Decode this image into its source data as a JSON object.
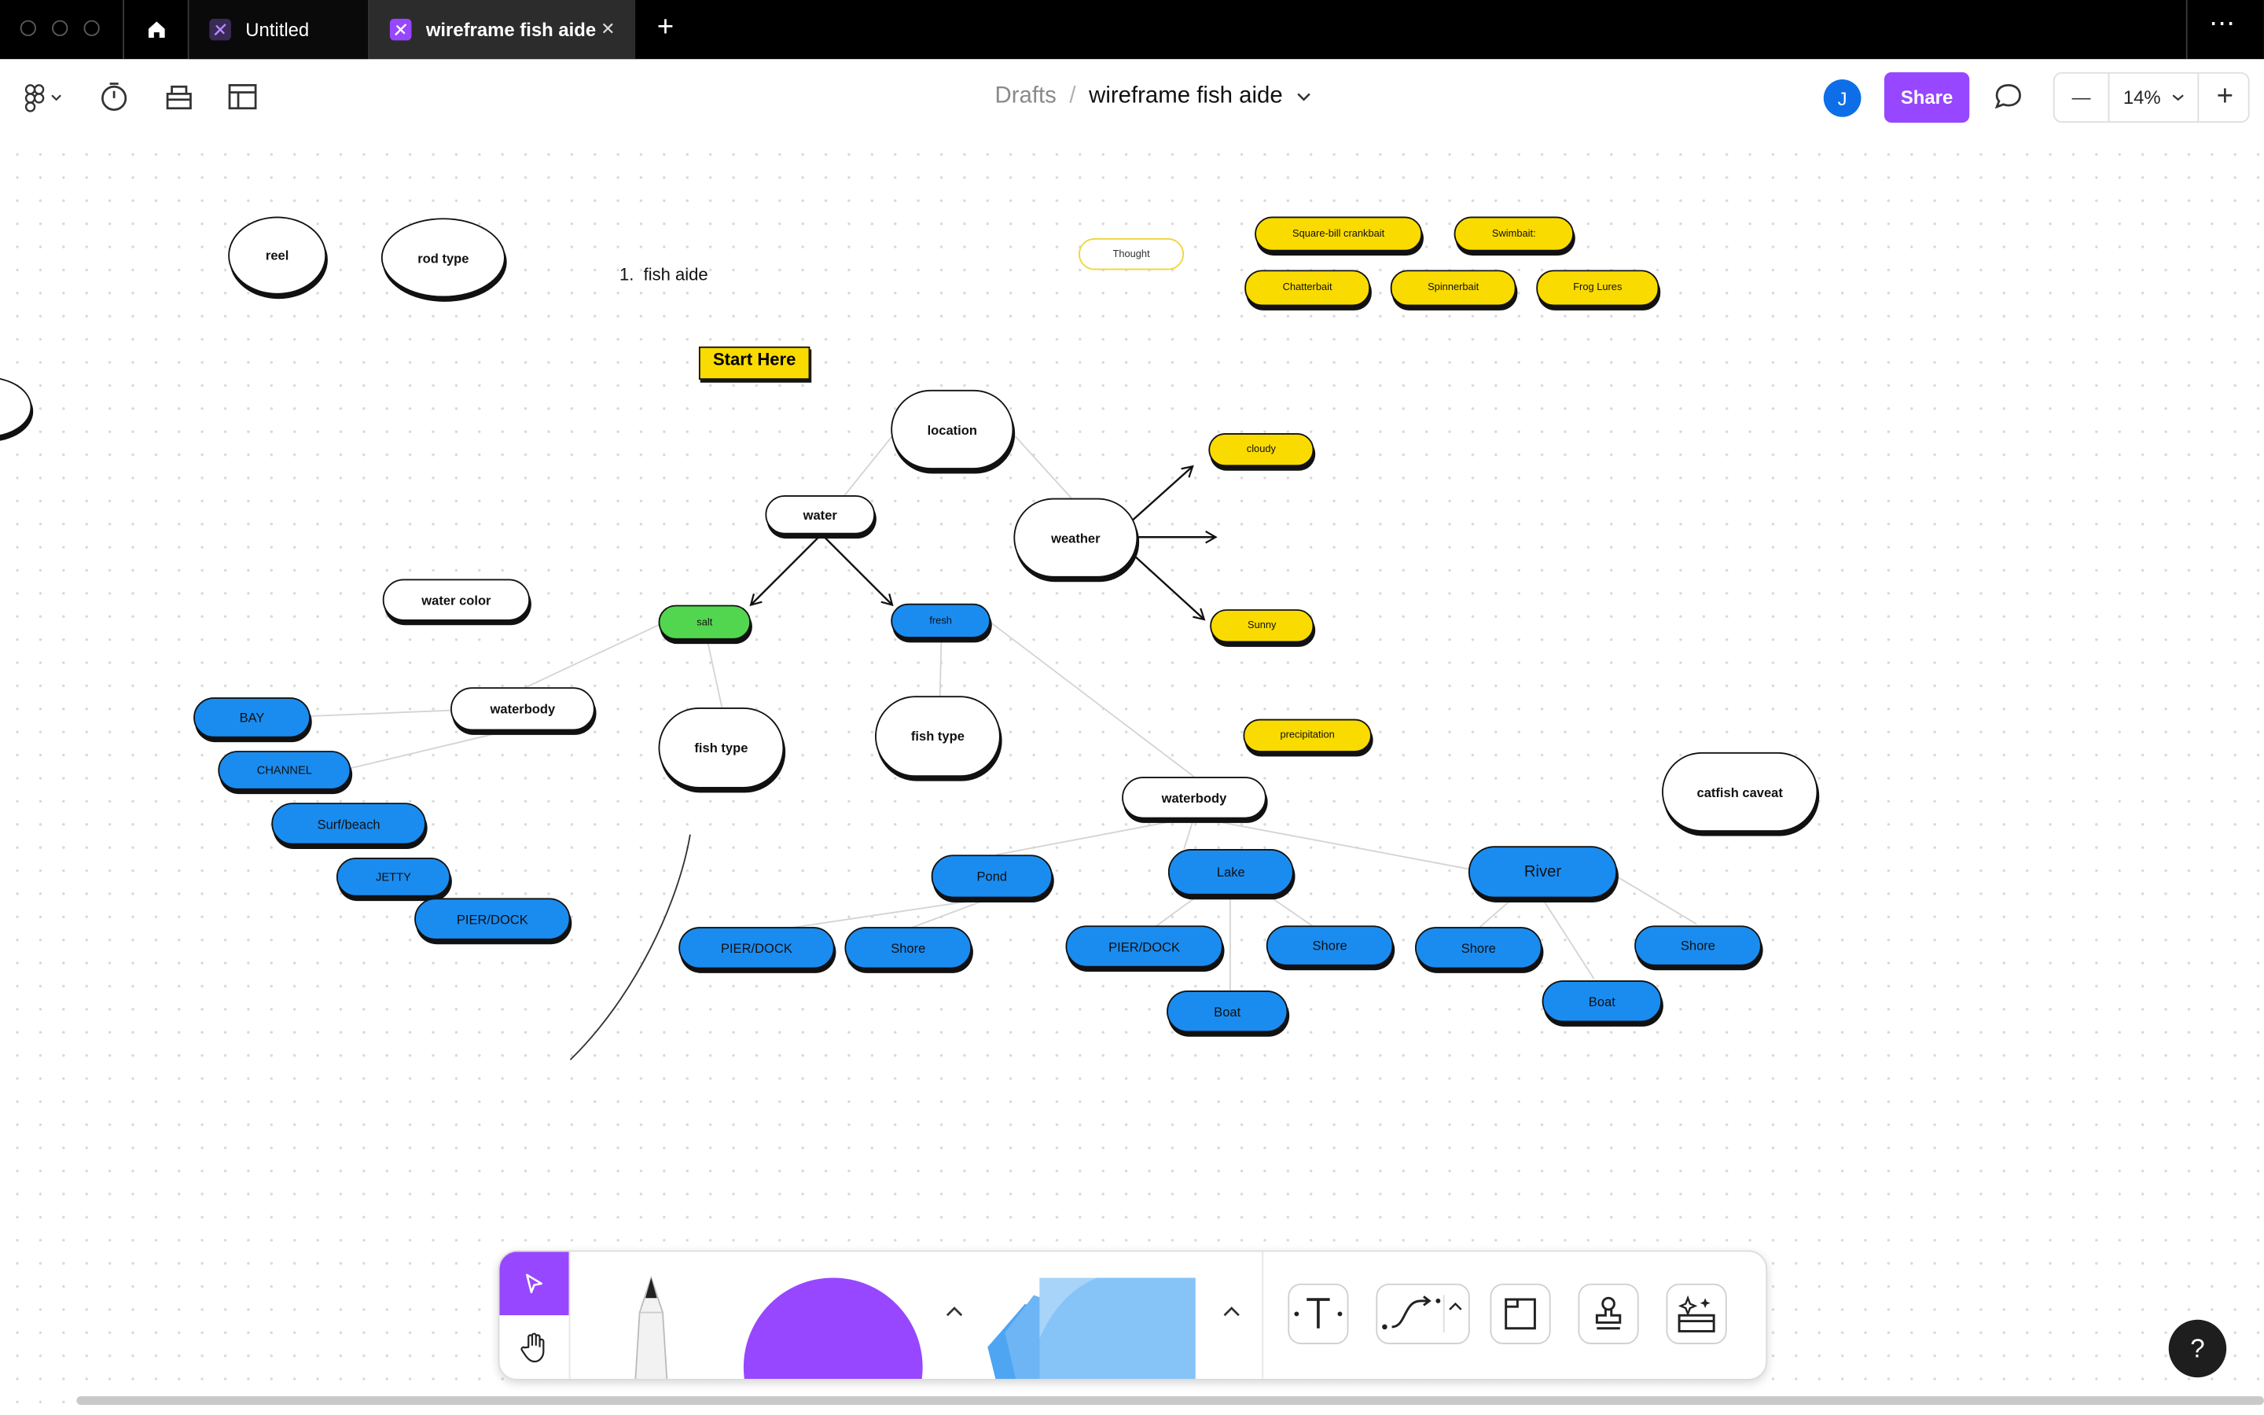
{
  "titlebar": {
    "tabs": [
      {
        "label": "Untitled",
        "icon": "figjam-file-icon",
        "active": false
      },
      {
        "label": "wireframe fish aide",
        "icon": "figjam-file-icon",
        "active": true
      }
    ],
    "new_tab": "+",
    "close": "✕",
    "more": "⋯"
  },
  "toolbar": {
    "breadcrumb_parent": "Drafts",
    "breadcrumb_sep": "/",
    "file_name": "wireframe fish aide",
    "avatar_initial": "J",
    "share_label": "Share",
    "zoom_minus": "—",
    "zoom_level": "14%",
    "zoom_plus": "+"
  },
  "canvas": {
    "texts": {
      "numbered_item": "1.  fish aide",
      "start_here": "Start Here"
    },
    "nodes": {
      "reel": "reel",
      "rod_type": "rod type",
      "thought": "Thought",
      "lure1": "Square-bill crankbait",
      "lure2": "Swimbait:",
      "lure3": "Chatterbait",
      "lure4": "Spinnerbait",
      "lure5": "Frog Lures",
      "location": "location",
      "water": "water",
      "weather": "weather",
      "cloudy": "cloudy",
      "sunny": "Sunny",
      "precipitation": "precipitation",
      "water_color": "water color",
      "salt": "salt",
      "fresh": "fresh",
      "salt_waterbody": "waterbody",
      "salt_fish_type": "fish type",
      "fresh_fish_type": "fish type",
      "bay": "BAY",
      "channel": "CHANNEL",
      "surf": "Surf/beach",
      "jetty": "JETTY",
      "salt_pier": "PIER/DOCK",
      "fresh_waterbody": "waterbody",
      "catfish": "catfish caveat",
      "pond": "Pond",
      "lake": "Lake",
      "river": "River",
      "pond_pier": "PIER/DOCK",
      "pond_shore": "Shore",
      "lake_pier": "PIER/DOCK",
      "lake_shore": "Shore",
      "lake_boat": "Boat",
      "river_shore1": "Shore",
      "river_shore2": "Shore",
      "river_boat": "Boat"
    }
  },
  "dock": {
    "tools": [
      "select-tool",
      "hand-tool",
      "marker-tool",
      "shape-tool",
      "sticky-tool",
      "text-tool",
      "connector-tool",
      "section-tool",
      "stamp-tool",
      "more-tools"
    ]
  },
  "help_label": "?",
  "colors": {
    "accent_purple": "#9747ff",
    "node_blue": "#1a8cf0",
    "node_yellow": "#fadb00",
    "node_green": "#52d64f",
    "avatar_blue": "#0d6ee8"
  }
}
